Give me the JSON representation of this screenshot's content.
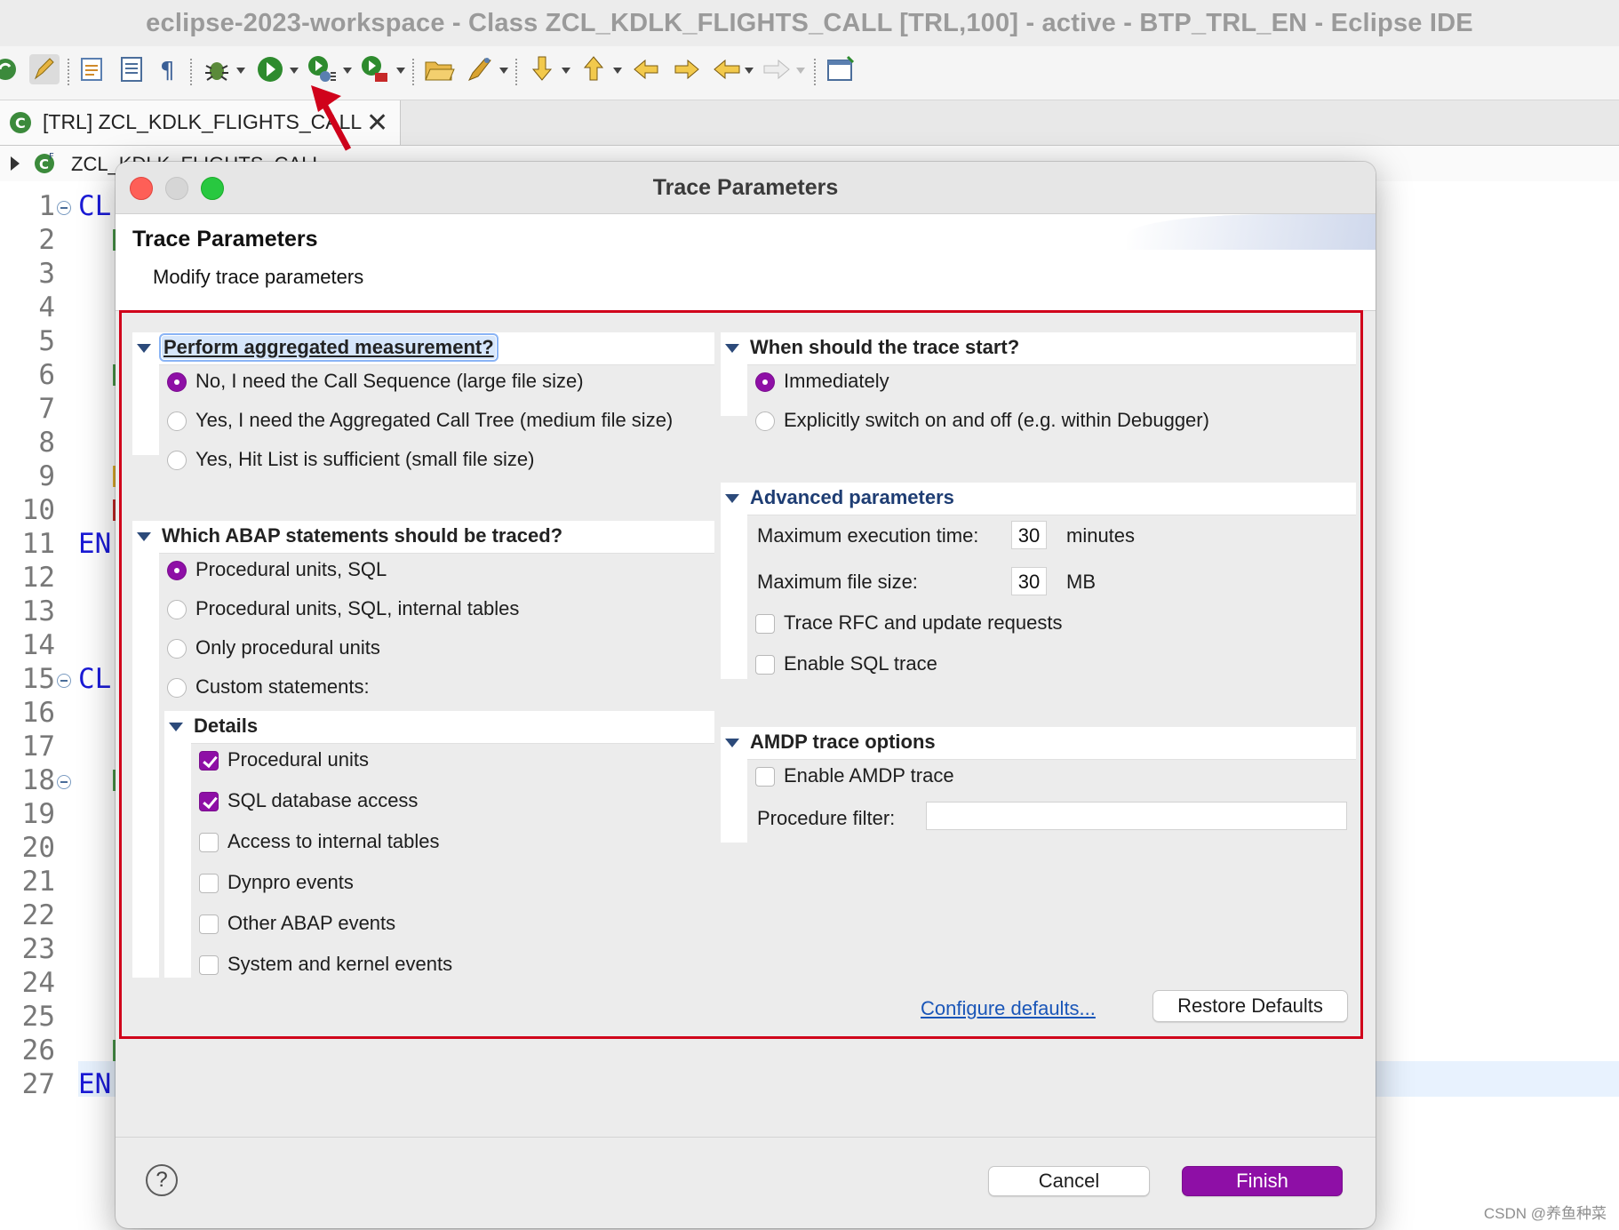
{
  "window": {
    "title": "eclipse-2023-workspace - Class ZCL_KDLK_FLIGHTS_CALL [TRL,100] - active - BTP_TRL_EN - Eclipse IDE"
  },
  "toolbar": {
    "icons": [
      "sync-icon",
      "edit-pencil-icon",
      "activate-icon",
      "document-icon",
      "pilcrow-icon",
      "debug-bug-icon",
      "run-icon",
      "profile-icon",
      "coverage-icon",
      "open-folder-icon",
      "launch-icon",
      "next-annotation-icon",
      "prev-annotation-icon",
      "back-edit-icon",
      "forward-edit-icon",
      "back-icon",
      "forward-icon",
      "new-window-icon"
    ]
  },
  "editor": {
    "tab_label": "[TRL] ZCL_KDLK_FLIGHTS_CALL",
    "breadcrumb": "ZCL_KDLK_FLIGHTS_CALL",
    "line_numbers": [
      "1",
      "2",
      "3",
      "4",
      "5",
      "6",
      "7",
      "8",
      "9",
      "10",
      "11",
      "12",
      "13",
      "14",
      "15",
      "16",
      "17",
      "18",
      "19",
      "20",
      "21",
      "22",
      "23",
      "24",
      "25",
      "26",
      "27"
    ],
    "code_fragments": {
      "line1": "CL",
      "line11": "EN",
      "line15": "CL",
      "line27": "EN"
    }
  },
  "dialog": {
    "window_title": "Trace Parameters",
    "header_title": "Trace Parameters",
    "header_subtitle": "Modify trace parameters",
    "aggregated": {
      "heading": "Perform aggregated measurement?",
      "options": [
        "No, I need the Call Sequence (large file size)",
        "Yes, I need the Aggregated Call Tree (medium file size)",
        "Yes, Hit List is sufficient (small file size)"
      ],
      "selected": 0
    },
    "statements": {
      "heading": "Which ABAP statements should be traced?",
      "options": [
        "Procedural units, SQL",
        "Procedural units, SQL, internal tables",
        "Only procedural units",
        "Custom statements:"
      ],
      "selected": 0
    },
    "details": {
      "heading": "Details",
      "items": [
        {
          "label": "Procedural units",
          "checked": true
        },
        {
          "label": "SQL database access",
          "checked": true
        },
        {
          "label": "Access to internal tables",
          "checked": false
        },
        {
          "label": "Dynpro events",
          "checked": false
        },
        {
          "label": "Other ABAP events",
          "checked": false
        },
        {
          "label": "System and kernel events",
          "checked": false
        }
      ]
    },
    "start": {
      "heading": "When should the trace start?",
      "options": [
        "Immediately",
        "Explicitly switch on and off (e.g. within Debugger)"
      ],
      "selected": 0
    },
    "advanced": {
      "heading": "Advanced parameters",
      "max_exec_label": "Maximum execution time:",
      "max_exec_value": "30",
      "max_exec_unit": "minutes",
      "max_file_label": "Maximum file size:",
      "max_file_value": "30",
      "max_file_unit": "MB",
      "rfc_label": "Trace RFC and update requests",
      "rfc_checked": false,
      "sql_label": "Enable SQL trace",
      "sql_checked": false
    },
    "amdp": {
      "heading": "AMDP trace options",
      "enable_label": "Enable AMDP trace",
      "enable_checked": false,
      "filter_label": "Procedure filter:",
      "filter_value": ""
    },
    "configure_link": "Configure defaults...",
    "restore_button": "Restore Defaults",
    "help_glyph": "?",
    "cancel_button": "Cancel",
    "finish_button": "Finish"
  },
  "watermark": "CSDN @养鱼种菜",
  "colors": {
    "accent": "#8e0fa6",
    "highlight_border": "#d0021b",
    "link": "#1a56b8"
  }
}
